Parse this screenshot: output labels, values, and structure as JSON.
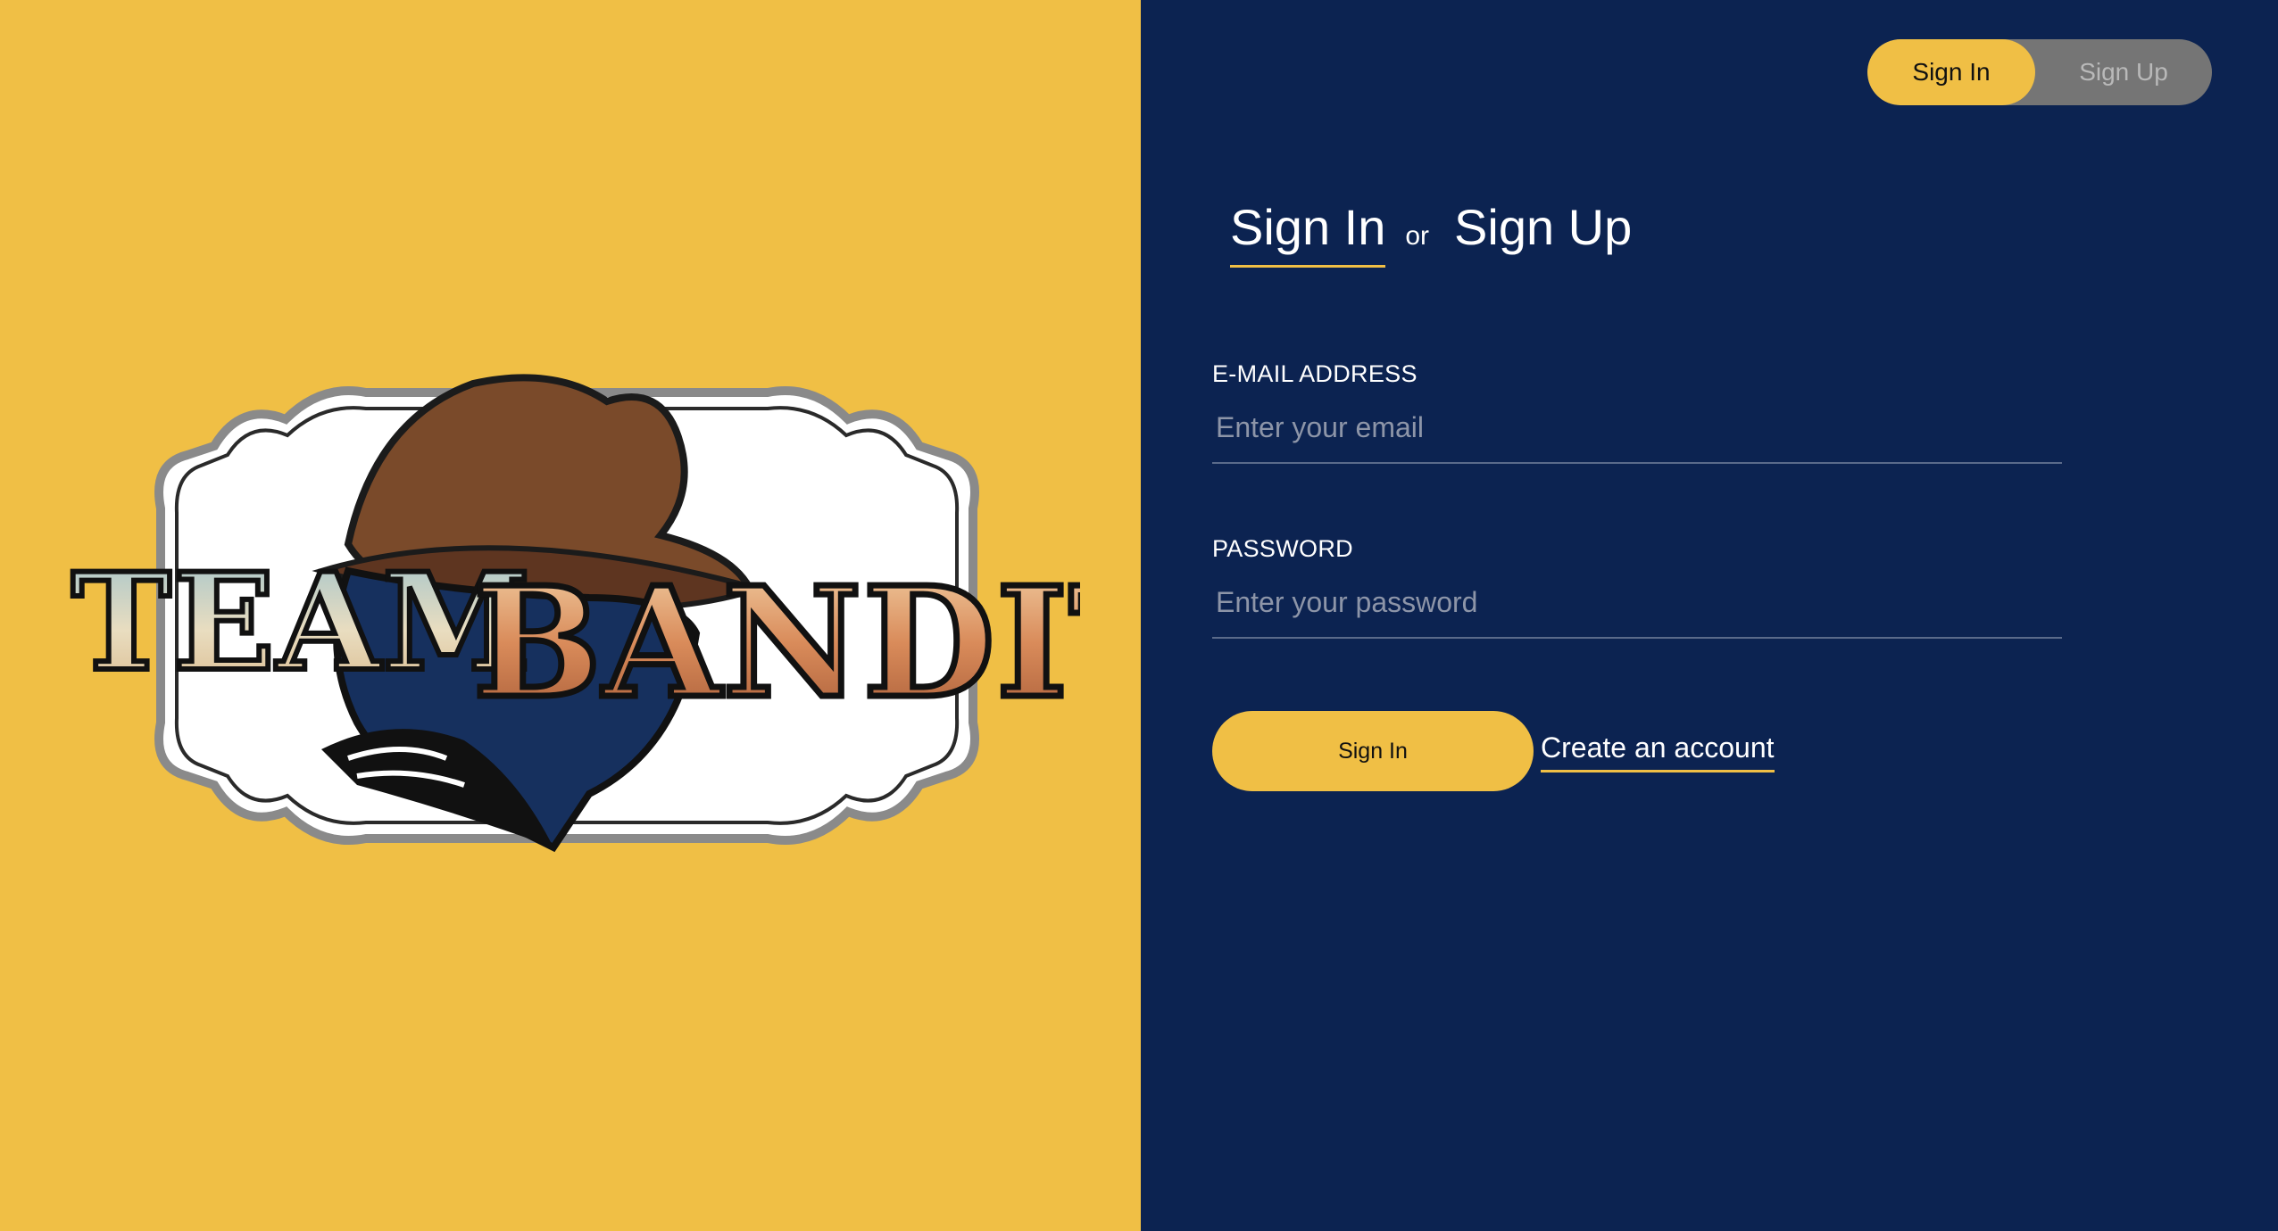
{
  "brand": {
    "logo_text_left": "TEAM",
    "logo_text_right": "BANDIT",
    "colors": {
      "accent": "#F0BF45",
      "panel": "#0C2351",
      "toggle_inactive": "#757575"
    }
  },
  "toggle": {
    "sign_in_label": "Sign In",
    "sign_up_label": "Sign Up",
    "active": "Sign In"
  },
  "heading": {
    "sign_in": "Sign In",
    "or": "or",
    "sign_up": "Sign Up"
  },
  "form": {
    "email_label": "E-MAIL ADDRESS",
    "email_placeholder": "Enter your email",
    "password_label": "PASSWORD",
    "password_placeholder": "Enter your password",
    "submit_label": "Sign In",
    "create_account_label": "Create an account"
  }
}
